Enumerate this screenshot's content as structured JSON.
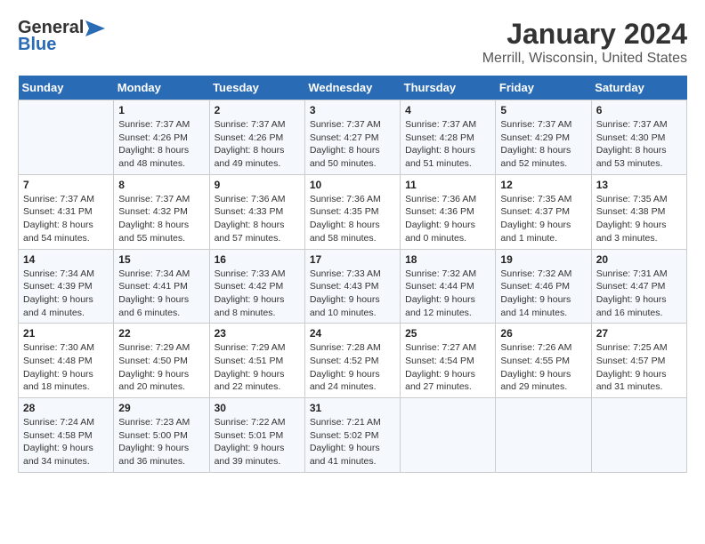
{
  "header": {
    "logo_line1": "General",
    "logo_line2": "Blue",
    "title": "January 2024",
    "subtitle": "Merrill, Wisconsin, United States"
  },
  "days_of_week": [
    "Sunday",
    "Monday",
    "Tuesday",
    "Wednesday",
    "Thursday",
    "Friday",
    "Saturday"
  ],
  "weeks": [
    [
      {
        "day": "",
        "sunrise": "",
        "sunset": "",
        "daylight": ""
      },
      {
        "day": "1",
        "sunrise": "Sunrise: 7:37 AM",
        "sunset": "Sunset: 4:26 PM",
        "daylight": "Daylight: 8 hours and 48 minutes."
      },
      {
        "day": "2",
        "sunrise": "Sunrise: 7:37 AM",
        "sunset": "Sunset: 4:26 PM",
        "daylight": "Daylight: 8 hours and 49 minutes."
      },
      {
        "day": "3",
        "sunrise": "Sunrise: 7:37 AM",
        "sunset": "Sunset: 4:27 PM",
        "daylight": "Daylight: 8 hours and 50 minutes."
      },
      {
        "day": "4",
        "sunrise": "Sunrise: 7:37 AM",
        "sunset": "Sunset: 4:28 PM",
        "daylight": "Daylight: 8 hours and 51 minutes."
      },
      {
        "day": "5",
        "sunrise": "Sunrise: 7:37 AM",
        "sunset": "Sunset: 4:29 PM",
        "daylight": "Daylight: 8 hours and 52 minutes."
      },
      {
        "day": "6",
        "sunrise": "Sunrise: 7:37 AM",
        "sunset": "Sunset: 4:30 PM",
        "daylight": "Daylight: 8 hours and 53 minutes."
      }
    ],
    [
      {
        "day": "7",
        "sunrise": "Sunrise: 7:37 AM",
        "sunset": "Sunset: 4:31 PM",
        "daylight": "Daylight: 8 hours and 54 minutes."
      },
      {
        "day": "8",
        "sunrise": "Sunrise: 7:37 AM",
        "sunset": "Sunset: 4:32 PM",
        "daylight": "Daylight: 8 hours and 55 minutes."
      },
      {
        "day": "9",
        "sunrise": "Sunrise: 7:36 AM",
        "sunset": "Sunset: 4:33 PM",
        "daylight": "Daylight: 8 hours and 57 minutes."
      },
      {
        "day": "10",
        "sunrise": "Sunrise: 7:36 AM",
        "sunset": "Sunset: 4:35 PM",
        "daylight": "Daylight: 8 hours and 58 minutes."
      },
      {
        "day": "11",
        "sunrise": "Sunrise: 7:36 AM",
        "sunset": "Sunset: 4:36 PM",
        "daylight": "Daylight: 9 hours and 0 minutes."
      },
      {
        "day": "12",
        "sunrise": "Sunrise: 7:35 AM",
        "sunset": "Sunset: 4:37 PM",
        "daylight": "Daylight: 9 hours and 1 minute."
      },
      {
        "day": "13",
        "sunrise": "Sunrise: 7:35 AM",
        "sunset": "Sunset: 4:38 PM",
        "daylight": "Daylight: 9 hours and 3 minutes."
      }
    ],
    [
      {
        "day": "14",
        "sunrise": "Sunrise: 7:34 AM",
        "sunset": "Sunset: 4:39 PM",
        "daylight": "Daylight: 9 hours and 4 minutes."
      },
      {
        "day": "15",
        "sunrise": "Sunrise: 7:34 AM",
        "sunset": "Sunset: 4:41 PM",
        "daylight": "Daylight: 9 hours and 6 minutes."
      },
      {
        "day": "16",
        "sunrise": "Sunrise: 7:33 AM",
        "sunset": "Sunset: 4:42 PM",
        "daylight": "Daylight: 9 hours and 8 minutes."
      },
      {
        "day": "17",
        "sunrise": "Sunrise: 7:33 AM",
        "sunset": "Sunset: 4:43 PM",
        "daylight": "Daylight: 9 hours and 10 minutes."
      },
      {
        "day": "18",
        "sunrise": "Sunrise: 7:32 AM",
        "sunset": "Sunset: 4:44 PM",
        "daylight": "Daylight: 9 hours and 12 minutes."
      },
      {
        "day": "19",
        "sunrise": "Sunrise: 7:32 AM",
        "sunset": "Sunset: 4:46 PM",
        "daylight": "Daylight: 9 hours and 14 minutes."
      },
      {
        "day": "20",
        "sunrise": "Sunrise: 7:31 AM",
        "sunset": "Sunset: 4:47 PM",
        "daylight": "Daylight: 9 hours and 16 minutes."
      }
    ],
    [
      {
        "day": "21",
        "sunrise": "Sunrise: 7:30 AM",
        "sunset": "Sunset: 4:48 PM",
        "daylight": "Daylight: 9 hours and 18 minutes."
      },
      {
        "day": "22",
        "sunrise": "Sunrise: 7:29 AM",
        "sunset": "Sunset: 4:50 PM",
        "daylight": "Daylight: 9 hours and 20 minutes."
      },
      {
        "day": "23",
        "sunrise": "Sunrise: 7:29 AM",
        "sunset": "Sunset: 4:51 PM",
        "daylight": "Daylight: 9 hours and 22 minutes."
      },
      {
        "day": "24",
        "sunrise": "Sunrise: 7:28 AM",
        "sunset": "Sunset: 4:52 PM",
        "daylight": "Daylight: 9 hours and 24 minutes."
      },
      {
        "day": "25",
        "sunrise": "Sunrise: 7:27 AM",
        "sunset": "Sunset: 4:54 PM",
        "daylight": "Daylight: 9 hours and 27 minutes."
      },
      {
        "day": "26",
        "sunrise": "Sunrise: 7:26 AM",
        "sunset": "Sunset: 4:55 PM",
        "daylight": "Daylight: 9 hours and 29 minutes."
      },
      {
        "day": "27",
        "sunrise": "Sunrise: 7:25 AM",
        "sunset": "Sunset: 4:57 PM",
        "daylight": "Daylight: 9 hours and 31 minutes."
      }
    ],
    [
      {
        "day": "28",
        "sunrise": "Sunrise: 7:24 AM",
        "sunset": "Sunset: 4:58 PM",
        "daylight": "Daylight: 9 hours and 34 minutes."
      },
      {
        "day": "29",
        "sunrise": "Sunrise: 7:23 AM",
        "sunset": "Sunset: 5:00 PM",
        "daylight": "Daylight: 9 hours and 36 minutes."
      },
      {
        "day": "30",
        "sunrise": "Sunrise: 7:22 AM",
        "sunset": "Sunset: 5:01 PM",
        "daylight": "Daylight: 9 hours and 39 minutes."
      },
      {
        "day": "31",
        "sunrise": "Sunrise: 7:21 AM",
        "sunset": "Sunset: 5:02 PM",
        "daylight": "Daylight: 9 hours and 41 minutes."
      },
      {
        "day": "",
        "sunrise": "",
        "sunset": "",
        "daylight": ""
      },
      {
        "day": "",
        "sunrise": "",
        "sunset": "",
        "daylight": ""
      },
      {
        "day": "",
        "sunrise": "",
        "sunset": "",
        "daylight": ""
      }
    ]
  ]
}
